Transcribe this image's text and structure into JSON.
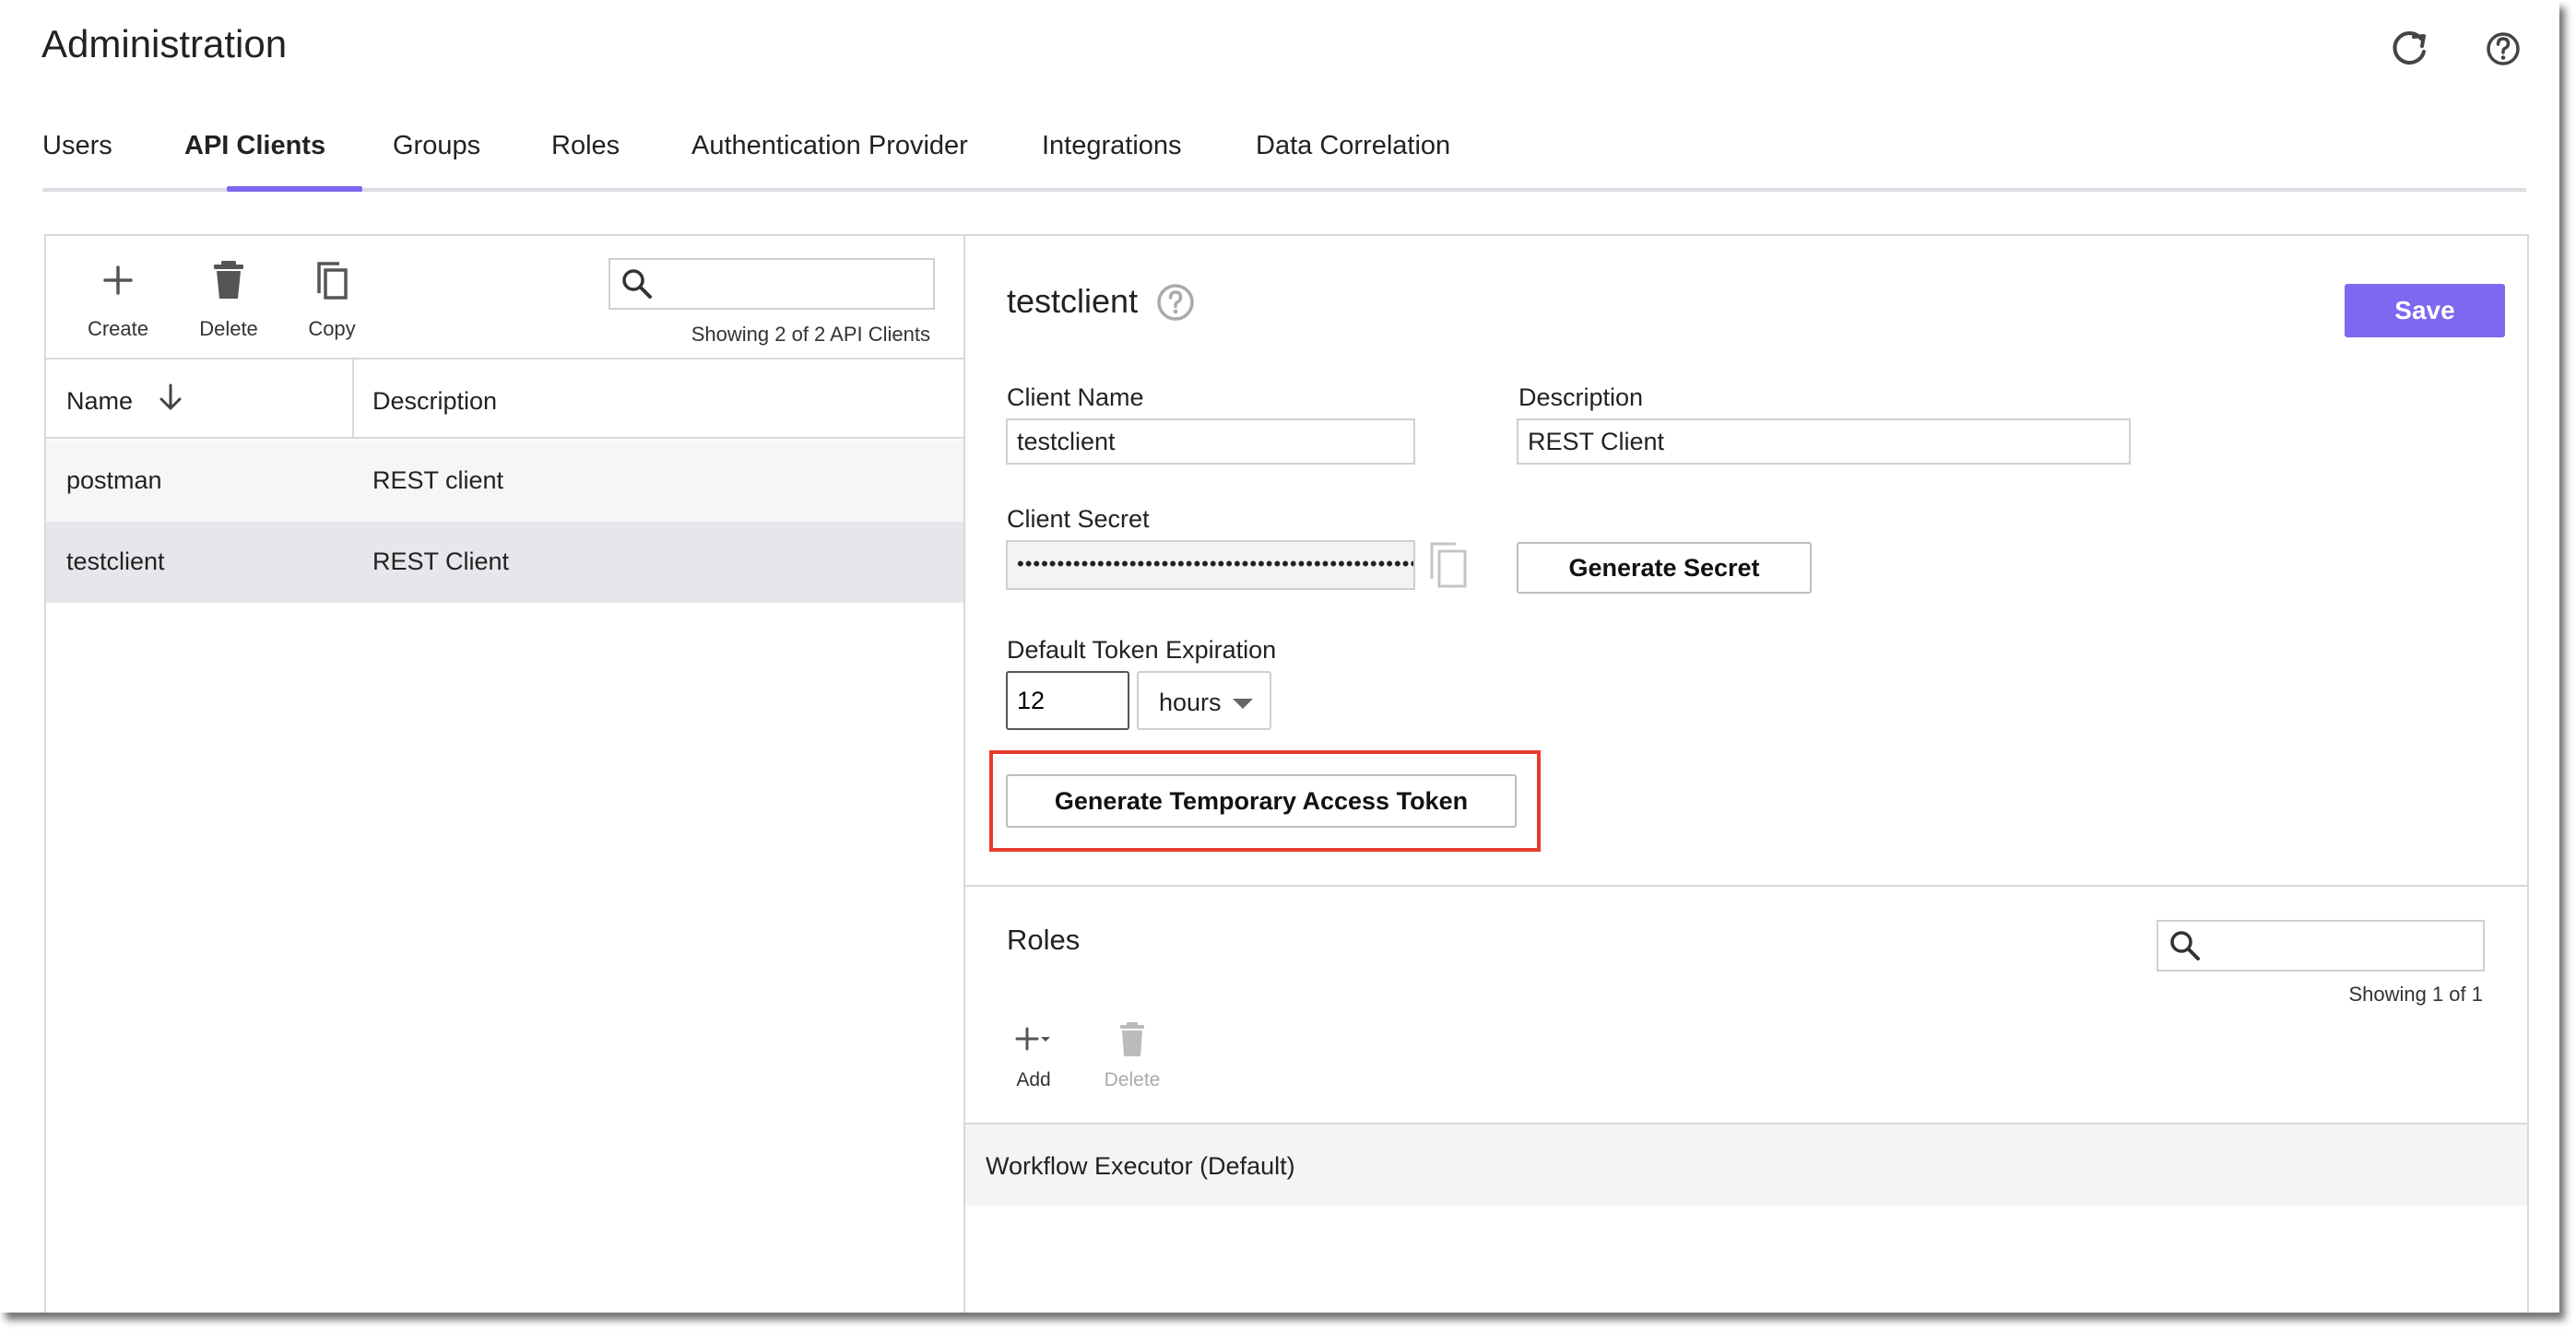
{
  "app": {
    "title": "Administration"
  },
  "header_icons": {
    "refresh": "refresh-icon",
    "help": "help-icon"
  },
  "tabs": [
    {
      "label": "Users",
      "active": false
    },
    {
      "label": "API Clients",
      "active": true
    },
    {
      "label": "Groups",
      "active": false
    },
    {
      "label": "Roles",
      "active": false
    },
    {
      "label": "Authentication Provider",
      "active": false
    },
    {
      "label": "Integrations",
      "active": false
    },
    {
      "label": "Data Correlation",
      "active": false
    }
  ],
  "list": {
    "toolbar": {
      "create": "Create",
      "delete": "Delete",
      "copy": "Copy"
    },
    "search_placeholder": "",
    "showing": "Showing 2 of 2 API Clients",
    "columns": {
      "name": "Name",
      "description": "Description"
    },
    "rows": [
      {
        "name": "postman",
        "description": "REST client",
        "selected": false
      },
      {
        "name": "testclient",
        "description": "REST Client",
        "selected": true
      }
    ]
  },
  "detail": {
    "title": "testclient",
    "save_label": "Save",
    "client_name_label": "Client Name",
    "client_name_value": "testclient",
    "description_label": "Description",
    "description_value": "REST Client",
    "client_secret_label": "Client Secret",
    "client_secret_value": "••••••••••••••••••••••••••••••••••••••••••••••••••",
    "generate_secret_label": "Generate Secret",
    "expiration_label": "Default Token Expiration",
    "expiration_value": "12",
    "expiration_unit": "hours",
    "generate_token_label": "Generate Temporary Access Token"
  },
  "roles": {
    "title": "Roles",
    "search_placeholder": "",
    "showing": "Showing 1 of 1",
    "add_label": "Add",
    "delete_label": "Delete",
    "items": [
      "Workflow Executor (Default)"
    ]
  },
  "colors": {
    "accent": "#7c69ef",
    "highlight": "#e53b2c",
    "selected_row": "#e6e7ea"
  }
}
